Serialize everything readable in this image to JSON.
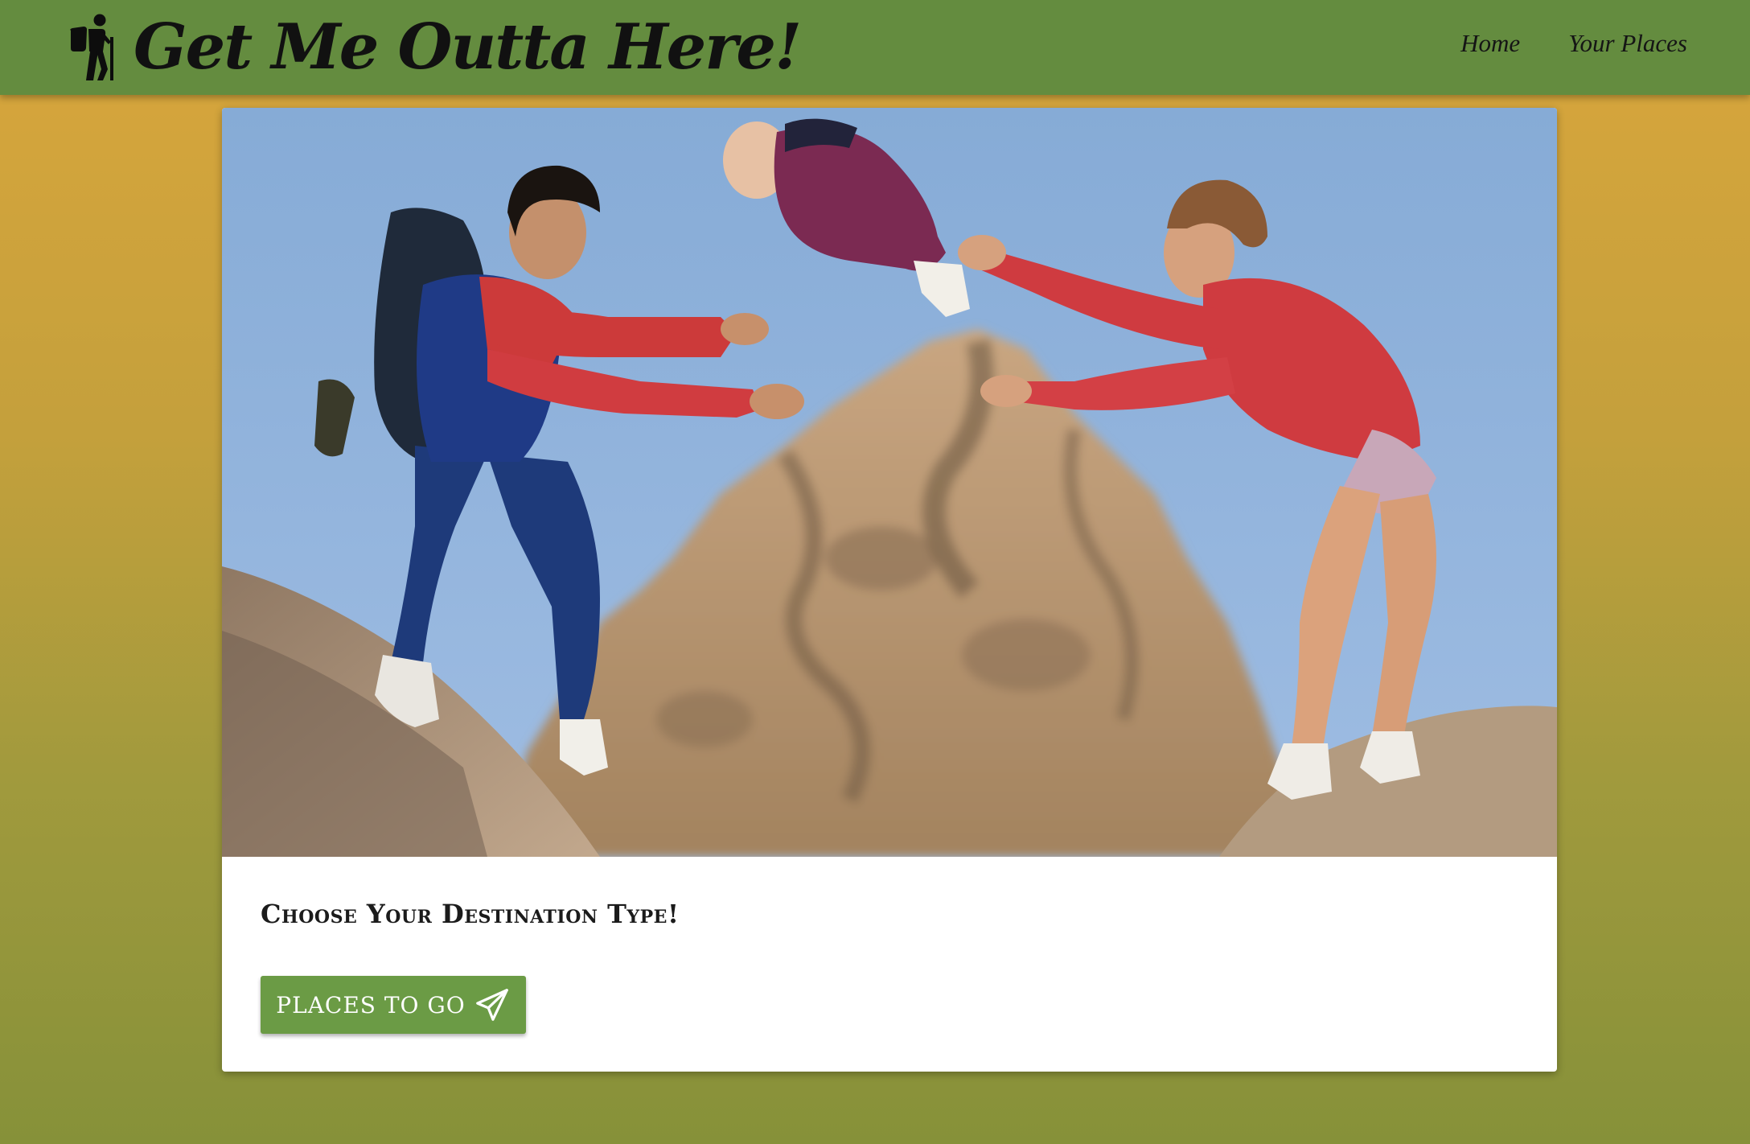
{
  "navbar": {
    "brand_title": "Get Me Outta Here!",
    "brand_icon": "hiker-icon",
    "links": [
      {
        "label": "Home"
      },
      {
        "label": "Your Places"
      }
    ],
    "background_color": "#648c3f"
  },
  "hero": {
    "image_description": "hero-photo-climbers-tossing-baby"
  },
  "card": {
    "title": "Choose Your Destination Type!",
    "button_label": "PLACES TO GO",
    "button_icon": "paper-plane-icon",
    "button_color": "#6b9b45"
  },
  "theme": {
    "background_top": "#d9a63c",
    "background_bottom": "#869139"
  }
}
